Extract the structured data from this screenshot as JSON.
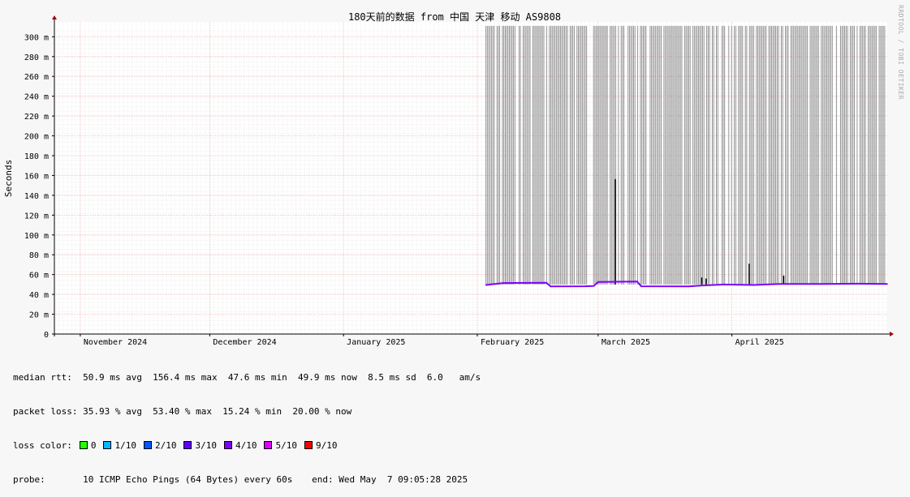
{
  "chart_data": {
    "type": "line",
    "title": "180天前的数据 from 中国 天津 移动 AS9808",
    "ylabel": "Seconds",
    "xlabel": "",
    "ylim": [
      0,
      315
    ],
    "y_unit": "ms",
    "y_ticks": [
      "0",
      "20 m",
      "40 m",
      "60 m",
      "80 m",
      "100 m",
      "120 m",
      "140 m",
      "160 m",
      "180 m",
      "200 m",
      "220 m",
      "240 m",
      "260 m",
      "280 m",
      "300 m"
    ],
    "x_range": [
      "2024-10-26",
      "2025-05-07"
    ],
    "x_ticks": [
      {
        "label": "November 2024",
        "date": "2024-11-01"
      },
      {
        "label": "December 2024",
        "date": "2024-12-01"
      },
      {
        "label": "January 2025",
        "date": "2025-01-01"
      },
      {
        "label": "February 2025",
        "date": "2025-02-01"
      },
      {
        "label": "March 2025",
        "date": "2025-03-01"
      },
      {
        "label": "April 2025",
        "date": "2025-04-01"
      }
    ],
    "grid": true,
    "median_rtt_series": {
      "name": "median rtt",
      "color": "#7e00ff",
      "points": [
        {
          "date": "2025-02-03",
          "ms": 49.5
        },
        {
          "date": "2025-02-07",
          "ms": 51.5
        },
        {
          "date": "2025-02-17",
          "ms": 51.8
        },
        {
          "date": "2025-02-18",
          "ms": 48.0
        },
        {
          "date": "2025-02-26",
          "ms": 48.2
        },
        {
          "date": "2025-02-28",
          "ms": 48.5
        },
        {
          "date": "2025-03-01",
          "ms": 52.5
        },
        {
          "date": "2025-03-10",
          "ms": 53.0
        },
        {
          "date": "2025-03-11",
          "ms": 48.2
        },
        {
          "date": "2025-03-22",
          "ms": 48.0
        },
        {
          "date": "2025-03-25",
          "ms": 49.0
        },
        {
          "date": "2025-03-30",
          "ms": 50.0
        },
        {
          "date": "2025-04-06",
          "ms": 49.5
        },
        {
          "date": "2025-04-12",
          "ms": 50.5
        },
        {
          "date": "2025-04-20",
          "ms": 50.5
        },
        {
          "date": "2025-04-30",
          "ms": 50.8
        },
        {
          "date": "2025-05-07",
          "ms": 50.5
        }
      ]
    },
    "spikes": [
      {
        "date": "2025-03-05",
        "ms": 156.4
      },
      {
        "date": "2025-03-25",
        "ms": 57
      },
      {
        "date": "2025-03-26",
        "ms": 56
      },
      {
        "date": "2025-04-05",
        "ms": 71
      },
      {
        "date": "2025-04-13",
        "ms": 59
      }
    ],
    "loss_period": [
      "2025-02-03",
      "2025-05-07"
    ]
  },
  "stats": {
    "median_rtt": "median rtt:  50.9 ms avg  156.4 ms max  47.6 ms min  49.9 ms now  8.5 ms sd  6.0   am/s",
    "packet_loss": "packet loss: 35.93 % avg  53.40 % max  15.24 % min  20.00 % now",
    "loss_color_label": "loss color:",
    "loss_colors": [
      {
        "label": "0",
        "color": "#26ff00"
      },
      {
        "label": "1/10",
        "color": "#00b8ff"
      },
      {
        "label": "2/10",
        "color": "#0059ff"
      },
      {
        "label": "3/10",
        "color": "#5e00ff"
      },
      {
        "label": "4/10",
        "color": "#7e00ff"
      },
      {
        "label": "5/10",
        "color": "#dd00ff"
      },
      {
        "label": "9/10",
        "color": "#ff0000"
      }
    ],
    "probe": "probe:       10 ICMP Echo Pings (64 Bytes) every 60s",
    "end": "end: Wed May  7 09:05:28 2025"
  },
  "watermark": "RRDTOOL / TOBI OETIKER"
}
